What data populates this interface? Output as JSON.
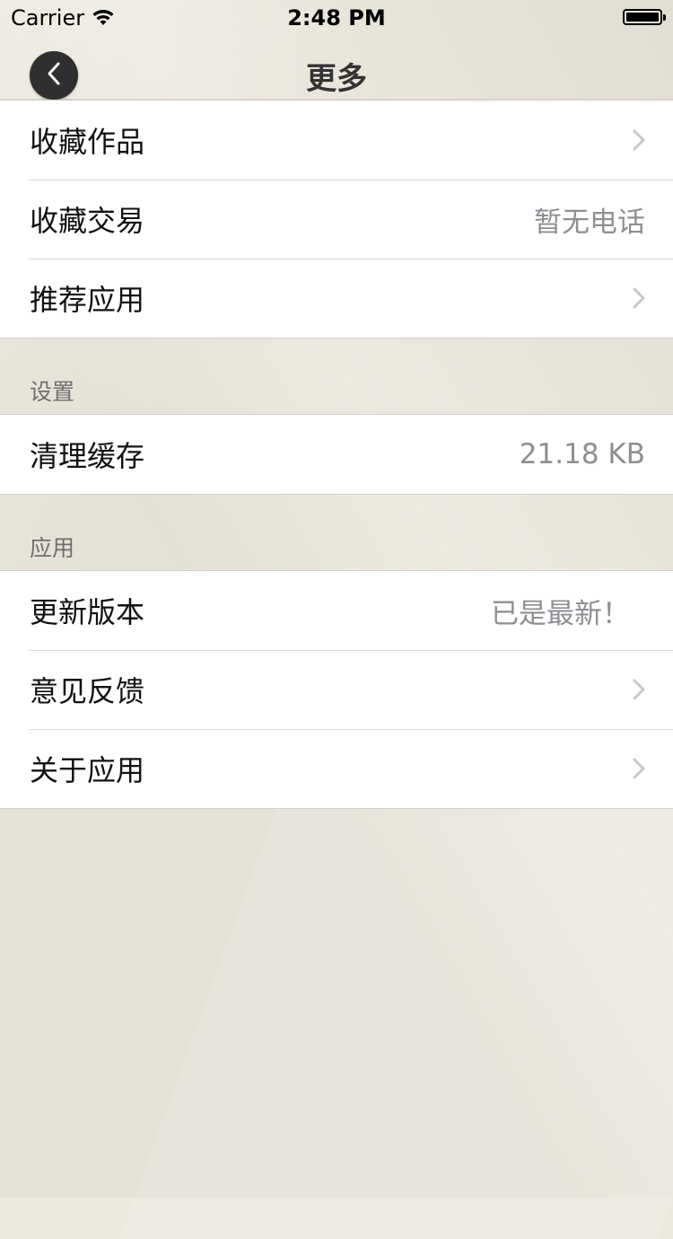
{
  "status_bar": {
    "carrier": "Carrier",
    "time": "2:48 PM",
    "icons": [
      "wifi-icon",
      "battery-icon"
    ]
  },
  "nav": {
    "title": "更多",
    "back_icon": "chevron-left-icon"
  },
  "group_top": {
    "rows": [
      {
        "label": "收藏作品",
        "value": null,
        "accessory": "chevron-right-icon"
      },
      {
        "label": "收藏交易",
        "value": "暂无电话",
        "accessory": null
      },
      {
        "label": "推荐应用",
        "value": null,
        "accessory": "chevron-right-icon"
      }
    ]
  },
  "section_settings": {
    "header": "设置",
    "rows": [
      {
        "label": "清理缓存",
        "value": "21.18 KB",
        "accessory": null
      }
    ]
  },
  "section_app": {
    "header": "应用",
    "rows": [
      {
        "label": "更新版本",
        "value": "已是最新！",
        "accessory": null
      },
      {
        "label": "意见反馈",
        "value": null,
        "accessory": "chevron-right-icon"
      },
      {
        "label": "关于应用",
        "value": null,
        "accessory": "chevron-right-icon"
      }
    ]
  },
  "colors": {
    "background": "#e9e5da",
    "cell": "#ffffff",
    "secondary_text": "#8e8e93",
    "chevron": "#c7c7cc",
    "back_button": "#2f2f2f"
  }
}
